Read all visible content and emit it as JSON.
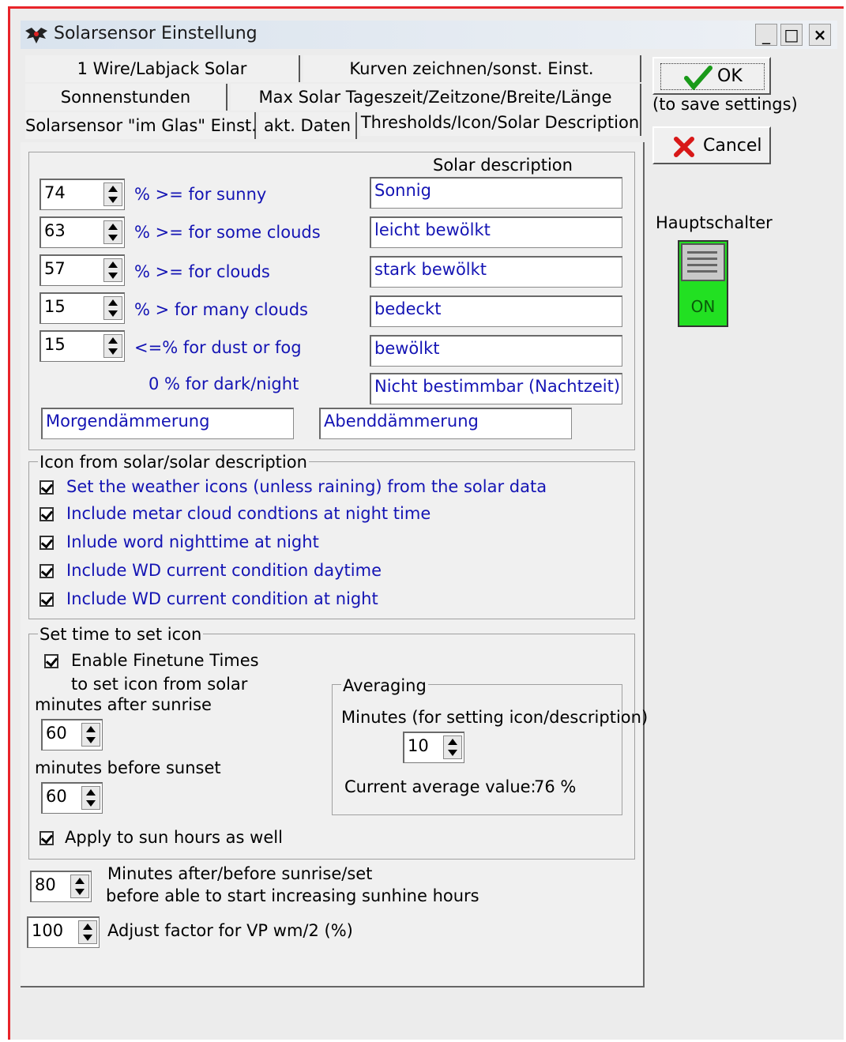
{
  "window": {
    "title": "Solarsensor Einstellung",
    "minimize": "_",
    "maximize": "□",
    "close": "×"
  },
  "tabs": {
    "row1": [
      "1 Wire/Labjack Solar",
      "Kurven zeichnen/sonst. Einst."
    ],
    "row2": [
      "Sonnenstunden",
      "Max Solar Tageszeit/Zeitzone/Breite/Länge"
    ],
    "row3": [
      "Solarsensor \"im Glas\" Einst.",
      "akt. Daten",
      "Thresholds/Icon/Solar Description"
    ]
  },
  "buttons": {
    "ok_label": "OK",
    "ok_note": "(to save settings)",
    "cancel_label": "Cancel"
  },
  "main_switch": {
    "label": "Hauptschalter",
    "state": "ON",
    "color": "#22e022"
  },
  "thresholds": {
    "header": "Solar description",
    "rows": [
      {
        "value": "74",
        "label": "% >= for sunny",
        "description": "Sonnig"
      },
      {
        "value": "63",
        "label": "% >= for some clouds",
        "description": "leicht bewölkt"
      },
      {
        "value": "57",
        "label": "% >= for clouds",
        "description": "stark bewölkt"
      },
      {
        "value": "15",
        "label": "% > for many clouds",
        "description": "bedeckt"
      },
      {
        "value": "15",
        "label": "<=%  for dust or fog",
        "description": "bewölkt"
      }
    ],
    "night_label": "0 %  for dark/night",
    "night_description": "Nicht bestimmbar (Nachtzeit)",
    "dawn": "Morgendämmerung",
    "dusk": "Abenddämmerung"
  },
  "icon_group": {
    "legend": "Icon from solar/solar description",
    "options": [
      "Set the weather icons (unless raining) from the solar data",
      "Include metar cloud condtions at night time",
      "Inlude word nighttime at night",
      "Include WD current condition daytime",
      "Include WD current condition at night"
    ]
  },
  "time_group": {
    "legend": "Set time to set icon",
    "finetune_label": "Enable Finetune Times",
    "sub_label": "to set icon from solar",
    "after_sunrise_label": "minutes after sunrise",
    "after_sunrise_value": "60",
    "before_sunset_label": "minutes before sunset",
    "before_sunset_value": "60",
    "apply_label": "Apply to sun hours as well",
    "averaging": {
      "legend": "Averaging",
      "minutes_label": "Minutes (for setting icon/description)",
      "minutes_value": "10",
      "current_label": "Current average value:",
      "current_value": "76 %"
    }
  },
  "sunhours": {
    "value": "80",
    "line1": "Minutes after/before sunrise/set",
    "line2": "before able to start increasing sunhine hours"
  },
  "adjust": {
    "value": "100",
    "label": "Adjust factor for VP wm/2 (%)"
  }
}
